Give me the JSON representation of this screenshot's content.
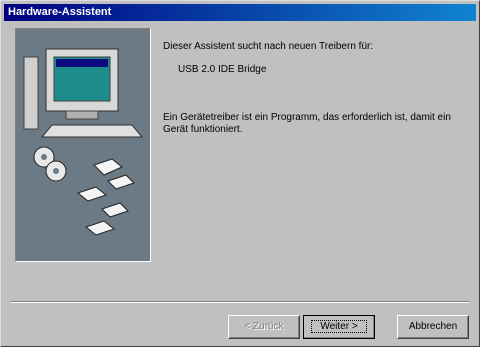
{
  "window": {
    "title": "Hardware-Assistent"
  },
  "content": {
    "intro": "Dieser Assistent sucht nach neuen Treibern für:",
    "device": "USB 2.0 IDE Bridge",
    "description": "Ein Gerätetreiber ist ein Programm, das erforderlich ist, damit ein Gerät funktioniert."
  },
  "buttons": {
    "back": "< Zurück",
    "next": "Weiter >",
    "cancel": "Abbrechen"
  }
}
